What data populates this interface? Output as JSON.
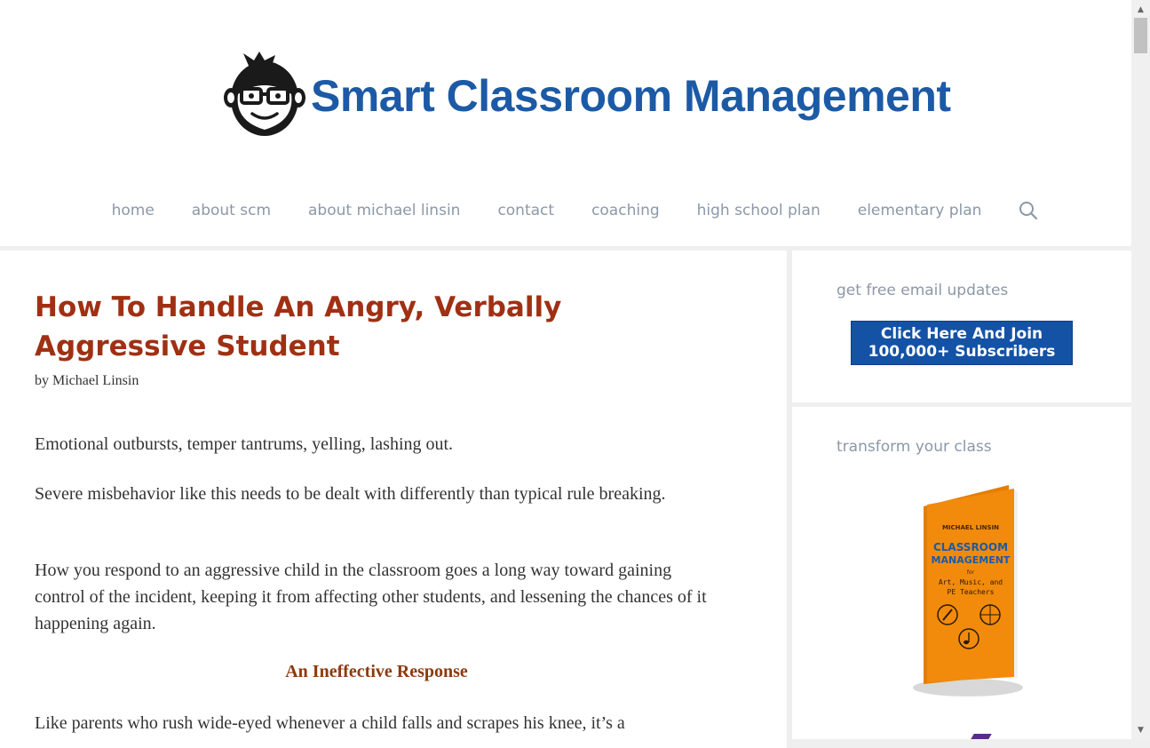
{
  "site": {
    "logo_text": "Smart Classroom Management",
    "brand_color": "#1c5aa6",
    "logo_icon": "monkey-with-glasses-icon"
  },
  "nav": {
    "items": [
      {
        "label": "home"
      },
      {
        "label": "about scm"
      },
      {
        "label": "about michael linsin"
      },
      {
        "label": "contact"
      },
      {
        "label": "coaching"
      },
      {
        "label": "high school plan"
      },
      {
        "label": "elementary plan"
      }
    ],
    "search_icon": "search-icon"
  },
  "article": {
    "title": "How To Handle An Angry, Verbally Aggressive Student",
    "byline": "by Michael Linsin",
    "title_color": "#a03013",
    "paragraphs": [
      "Emotional outbursts, temper tantrums, yelling, lashing out.",
      "Severe misbehavior like this needs to be dealt with differently than typical rule breaking.",
      "How you respond to an aggressive child in the classroom goes a long way toward gaining control of the incident, keeping it from affecting other students, and lessening the chances of it happening again.",
      "Like parents who rush wide-eyed whenever a child falls and scrapes his knee, it’s a"
    ],
    "subheading": "An Ineffective Response"
  },
  "sidebar": {
    "email_widget": {
      "title": "get free email updates",
      "button_line1": "Click Here And Join",
      "button_line2": "100,000+ Subscribers",
      "button_color": "#1452a6"
    },
    "book_widget": {
      "title": "transform your class",
      "book_author": "MICHAEL LINSIN",
      "book_title_line1": "CLASSROOM",
      "book_title_line2": "MANAGEMENT",
      "book_for": "for",
      "book_subtitle_line1": "Art, Music, and",
      "book_subtitle_line2": "PE Teachers",
      "book_color": "#f28b0c"
    }
  }
}
